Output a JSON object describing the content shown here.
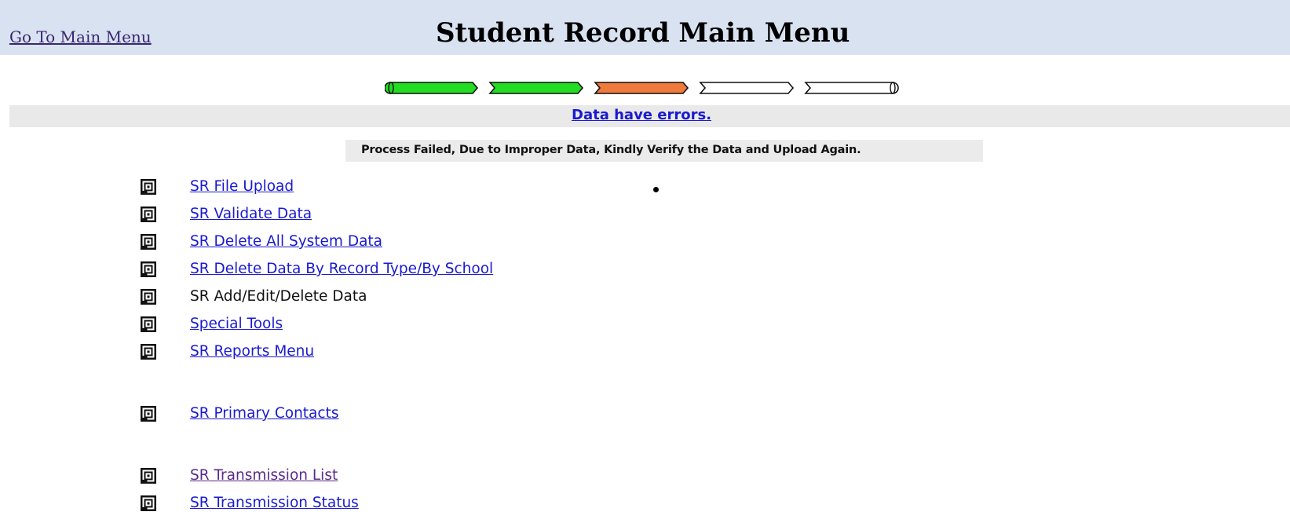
{
  "header": {
    "main_menu_link": "Go To Main Menu",
    "title": "Student Record Main Menu"
  },
  "progress": {
    "steps": [
      "complete",
      "complete",
      "error",
      "pending",
      "pending"
    ],
    "colors": {
      "complete": "#22dd22",
      "error": "#f07a3c",
      "pending": "#ffffff"
    }
  },
  "status": {
    "link_text": "Data have errors.",
    "message": "Process Failed, Due to Improper Data, Kindly Verify the Data and Upload Again."
  },
  "menu": {
    "items": [
      {
        "label": "SR File Upload",
        "link": true
      },
      {
        "label": "SR Validate Data",
        "link": true
      },
      {
        "label": "SR Delete All System Data",
        "link": true
      },
      {
        "label": "SR Delete Data By Record Type/By School",
        "link": true
      },
      {
        "label": "SR Add/Edit/Delete Data",
        "link": false
      },
      {
        "label": "Special Tools",
        "link": true
      },
      {
        "label": "SR Reports Menu",
        "link": true
      },
      {
        "label": "SR Primary Contacts",
        "link": true
      },
      {
        "label": "SR Transmission List",
        "link": true
      },
      {
        "label": "SR Transmission Status",
        "link": true
      }
    ],
    "icon": "square-spiral-icon"
  },
  "colors": {
    "header_bg": "#d9e2f0",
    "link": "#1a1ad0",
    "visited_link": "#5a2a8a"
  }
}
